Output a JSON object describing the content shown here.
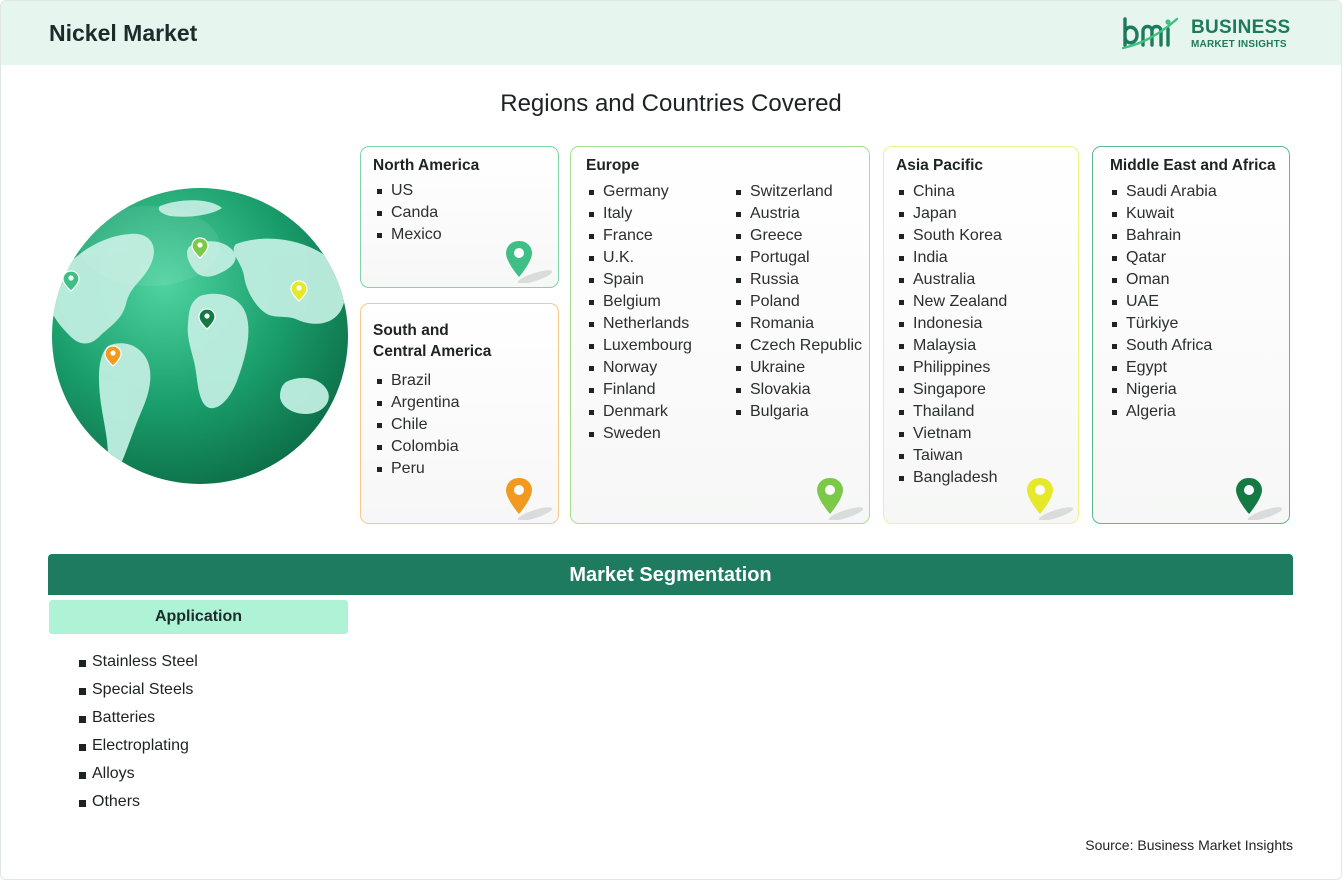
{
  "header": {
    "title": "Nickel Market",
    "logo": {
      "mark": "bmi",
      "line1": "BUSINESS",
      "line2": "MARKET INSIGHTS"
    }
  },
  "section_title": "Regions and Countries Covered",
  "regions": [
    {
      "name": "North America",
      "countries": [
        "US",
        "Canda",
        "Mexico"
      ],
      "pin_color": "#3dbf86",
      "border": "#7fd4a8"
    },
    {
      "name": "South and Central America",
      "name_lines": [
        "South and",
        "Central America"
      ],
      "countries": [
        "Brazil",
        "Argentina",
        "Chile",
        "Colombia",
        "Peru"
      ],
      "pin_color": "#f29a1f",
      "border": "#f6c98b"
    },
    {
      "name": "Europe",
      "countries": [
        "Germany",
        "Italy",
        "France",
        "U.K.",
        "Spain",
        "Belgium",
        "Netherlands",
        "Luxembourg",
        "Norway",
        "Finland",
        "Denmark",
        "Sweden",
        "Switzerland",
        "Austria",
        "Greece",
        "Portugal",
        "Russia",
        "Poland",
        "Romania",
        "Czech Republic",
        "Ukraine",
        "Slovakia",
        "Bulgaria"
      ],
      "pin_color": "#7cc94a",
      "border": "#a8df8c"
    },
    {
      "name": "Asia Pacific",
      "countries": [
        "China",
        "Japan",
        "South Korea",
        "India",
        "Australia",
        "New Zealand",
        "Indonesia",
        "Malaysia",
        "Philippines",
        "Singapore",
        "Thailand",
        "Vietnam",
        "Taiwan",
        "Bangladesh"
      ],
      "pin_color": "#e6e82a",
      "border": "#eef08a"
    },
    {
      "name": "Middle East and Africa",
      "countries": [
        "Saudi Arabia",
        "Kuwait",
        "Bahrain",
        "Qatar",
        "Oman",
        "UAE",
        "Türkiye",
        "South Africa",
        "Egypt",
        "Nigeria",
        "Algeria"
      ],
      "pin_color": "#137a44",
      "border": "#5cb98a"
    }
  ],
  "segmentation": {
    "title": "Market Segmentation",
    "tab": "Application",
    "items": [
      "Stainless Steel",
      "Special Steels",
      "Batteries",
      "Electroplating",
      "Alloys",
      "Others"
    ]
  },
  "source": "Source: Business Market Insights",
  "colors": {
    "brand": "#1e7b5f",
    "header_bg": "#e6f6ee",
    "tab_bg": "#aef3d6"
  }
}
